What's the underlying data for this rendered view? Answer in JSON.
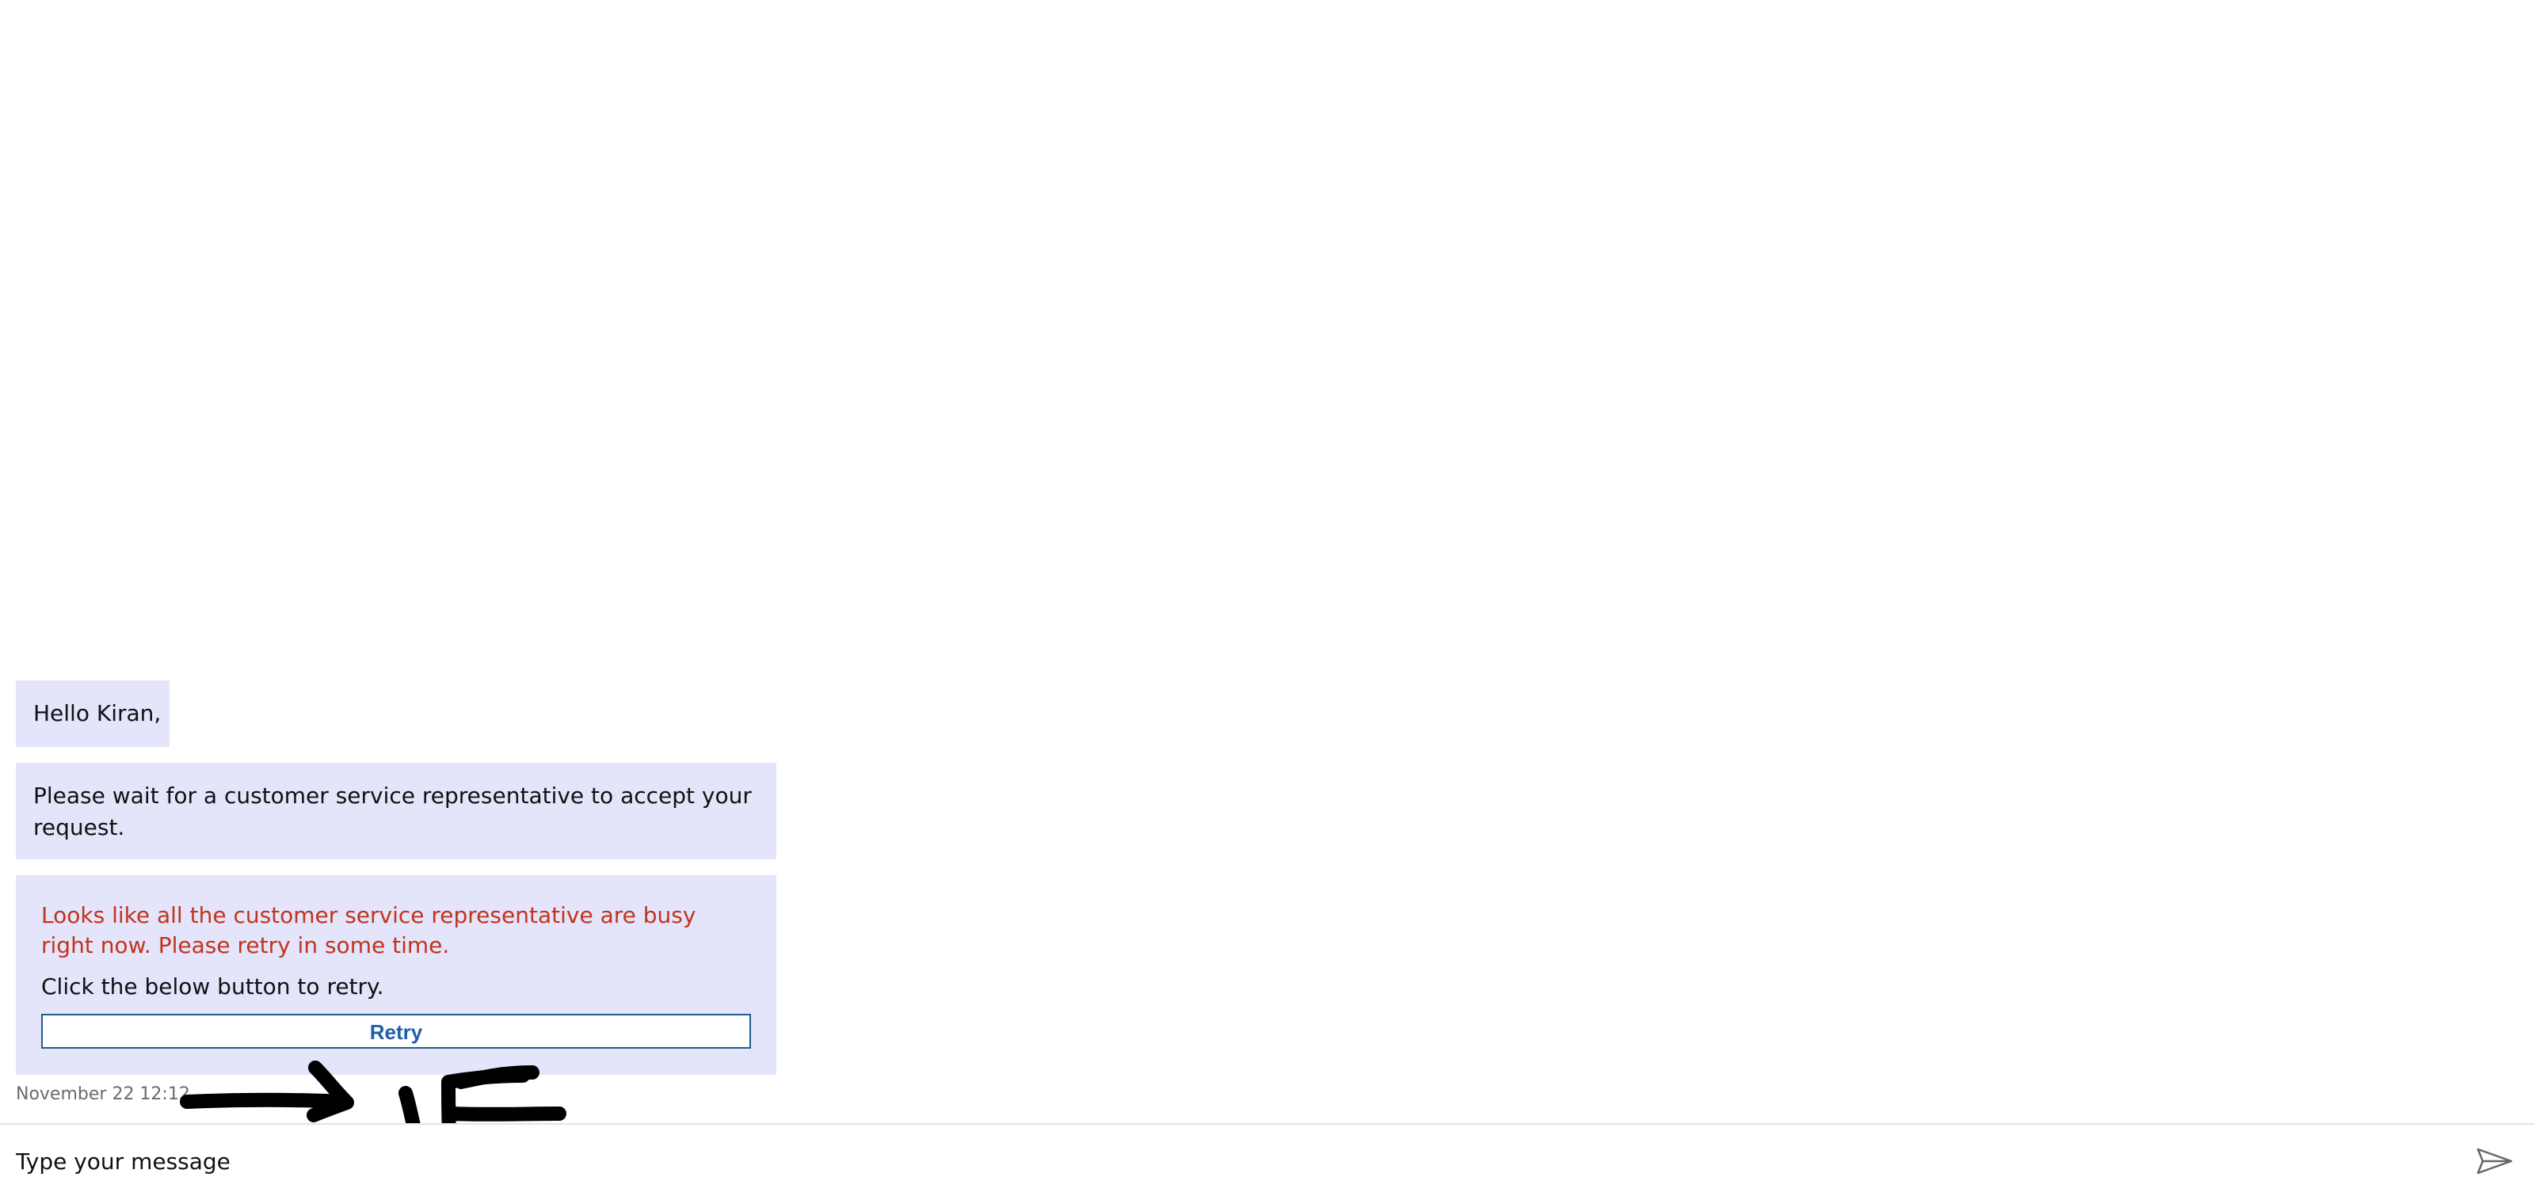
{
  "chat": {
    "greeting": "Hello Kiran,",
    "wait_message": "Please wait for a customer service representative to accept your request.",
    "busy_message": "Looks like all the customer service representative are busy right now. Please retry in some time.",
    "retry_prompt": "Click the below button to retry.",
    "retry_label": "Retry",
    "timestamp": "November 22 12:12"
  },
  "composer": {
    "placeholder": "Type your message",
    "send_icon": "send-icon"
  },
  "colors": {
    "bubble_bg": "#e4e4fb",
    "error_text": "#c1341b",
    "retry_text": "#1f5fa8",
    "retry_border": "#1d5e8c",
    "timestamp_text": "#6b6b6b",
    "annotation_ink": "#000000"
  }
}
